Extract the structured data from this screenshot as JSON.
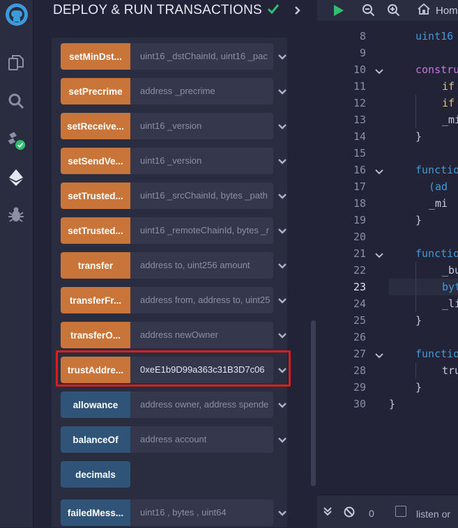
{
  "panel": {
    "title": "DEPLOY & RUN TRANSACTIONS"
  },
  "functions": [
    {
      "name": "setMinDst...",
      "params": "uint16 _dstChainId, uint16 _pac",
      "kind": "transact"
    },
    {
      "name": "setPrecrime",
      "params": "address _precrime",
      "kind": "transact"
    },
    {
      "name": "setReceive...",
      "params": "uint16 _version",
      "kind": "transact"
    },
    {
      "name": "setSendVe...",
      "params": "uint16 _version",
      "kind": "transact"
    },
    {
      "name": "setTrusted...",
      "params": "uint16 _srcChainId, bytes _path",
      "kind": "transact"
    },
    {
      "name": "setTrusted...",
      "params": "uint16 _remoteChainId, bytes _r",
      "kind": "transact"
    },
    {
      "name": "transfer",
      "params": "address to, uint256 amount",
      "kind": "transact"
    },
    {
      "name": "transferFr...",
      "params": "address from, address to, uint25",
      "kind": "transact"
    },
    {
      "name": "transferO...",
      "params": "address newOwner",
      "kind": "transact"
    },
    {
      "name": "trustAddre...",
      "value": "0xeE1b9D99a363c31B3D7c06",
      "kind": "transact",
      "highlighted": true
    },
    {
      "name": "allowance",
      "params": "address owner, address spende",
      "kind": "call"
    },
    {
      "name": "balanceOf",
      "params": "address account",
      "kind": "call"
    },
    {
      "name": "decimals",
      "params": "",
      "kind": "call"
    },
    {
      "name": "failedMess...",
      "params": "uint16 , bytes , uint64",
      "kind": "call"
    }
  ],
  "editor": {
    "home_tab": "Hom",
    "active_line": "23",
    "lines": [
      {
        "n": "8",
        "code": "uint16",
        "indent": 1,
        "color": "#3e9bdb"
      },
      {
        "n": "9",
        "code": "",
        "indent": 0
      },
      {
        "n": "10",
        "code": "constru",
        "indent": 1,
        "color": "#c678dd",
        "fold": true
      },
      {
        "n": "11",
        "code": "if",
        "indent": 2,
        "color": "#e5c07b"
      },
      {
        "n": "12",
        "code": "if",
        "indent": 2,
        "color": "#e5c07b"
      },
      {
        "n": "13",
        "code": "_mi",
        "indent": 2,
        "color": "#c7cadb"
      },
      {
        "n": "14",
        "code": "}",
        "indent": 1,
        "color": "#c7cadb"
      },
      {
        "n": "15",
        "code": "",
        "indent": 0
      },
      {
        "n": "16",
        "code": "functio",
        "indent": 1,
        "color": "#3e9bdb",
        "fold": true
      },
      {
        "n": "17",
        "code": "(ad",
        "indent": 1.5,
        "color": "#3e9bdb"
      },
      {
        "n": "18",
        "code": "_mi",
        "indent": 1.5,
        "color": "#c7cadb"
      },
      {
        "n": "19",
        "code": "}",
        "indent": 1,
        "color": "#c7cadb"
      },
      {
        "n": "20",
        "code": "",
        "indent": 0
      },
      {
        "n": "21",
        "code": "functio",
        "indent": 1,
        "color": "#3e9bdb",
        "fold": true
      },
      {
        "n": "22",
        "code": "_bu",
        "indent": 2,
        "color": "#c7cadb"
      },
      {
        "n": "23",
        "code": "byt",
        "indent": 2,
        "color": "#3e9bdb"
      },
      {
        "n": "24",
        "code": "_li",
        "indent": 2,
        "color": "#c7cadb"
      },
      {
        "n": "25",
        "code": "}",
        "indent": 1,
        "color": "#c7cadb"
      },
      {
        "n": "26",
        "code": "",
        "indent": 0
      },
      {
        "n": "27",
        "code": "functio",
        "indent": 1,
        "color": "#3e9bdb",
        "fold": true
      },
      {
        "n": "28",
        "code": "tru",
        "indent": 2,
        "color": "#c7cadb"
      },
      {
        "n": "29",
        "code": "}",
        "indent": 1,
        "color": "#c7cadb"
      },
      {
        "n": "30",
        "code": "}",
        "indent": 0,
        "color": "#c7cadb"
      }
    ]
  },
  "bottom_bar": {
    "count": "0",
    "listen_label": "listen or"
  },
  "colors": {
    "transact_button": "#c97539",
    "call_button": "#2f5477",
    "highlight": "#e01b1b",
    "success_check": "#2fbf71"
  }
}
